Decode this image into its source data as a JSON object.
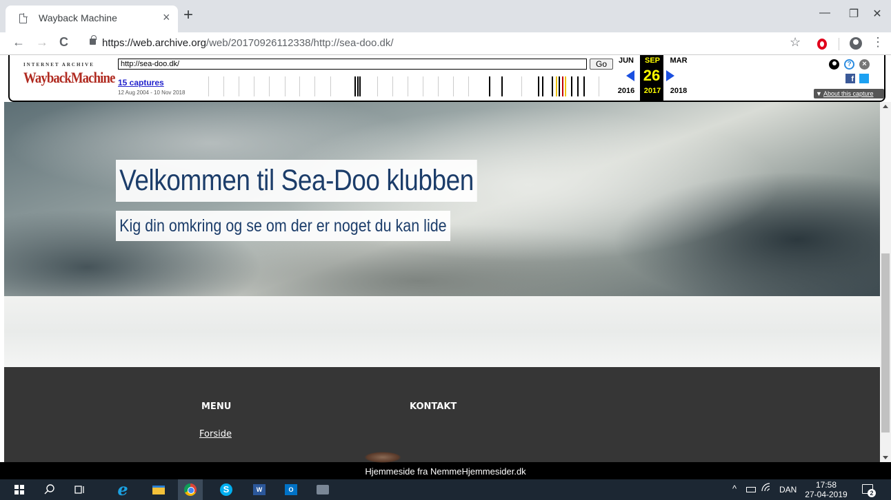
{
  "browser": {
    "tab_title": "Wayback Machine",
    "tab_close": "×",
    "new_tab": "+",
    "url_host": "https://web.archive.org",
    "url_path": "/web/20170926112338/http://sea-doo.dk/",
    "window_min": "—",
    "window_restore": "❐",
    "window_close": "✕",
    "back": "←",
    "forward": "→",
    "reload": "C",
    "star": "☆",
    "menu": "⋮"
  },
  "wayback": {
    "logo_top": "INTERNET ARCHIVE",
    "logo": "WaybackMachine",
    "url_value": "http://sea-doo.dk/",
    "go_label": "Go",
    "captures_label": "15 captures",
    "date_range": "12 Aug 2004 - 10 Nov 2018",
    "months": {
      "prev": "JUN",
      "current": "SEP",
      "next": "MAR"
    },
    "day": "26",
    "years": {
      "prev": "2016",
      "current": "2017",
      "next": "2018"
    },
    "help_glyph": "?",
    "close_glyph": "×",
    "facebook_glyph": "f",
    "about_label": "About this capture",
    "about_arrow": "▼",
    "sparkline": [
      {
        "x": 0.03,
        "c": "#ccc"
      },
      {
        "x": 0.068,
        "c": "#ccc"
      },
      {
        "x": 0.105,
        "c": "#ccc"
      },
      {
        "x": 0.142,
        "c": "#ccc"
      },
      {
        "x": 0.18,
        "c": "#ccc"
      },
      {
        "x": 0.218,
        "c": "#ccc"
      },
      {
        "x": 0.255,
        "c": "#ccc"
      },
      {
        "x": 0.292,
        "c": "#ccc"
      },
      {
        "x": 0.33,
        "c": "#ccc"
      },
      {
        "x": 0.39,
        "c": "#000",
        "w": 2
      },
      {
        "x": 0.396,
        "c": "#000",
        "w": 2
      },
      {
        "x": 0.402,
        "c": "#000",
        "w": 2
      },
      {
        "x": 0.445,
        "c": "#ccc"
      },
      {
        "x": 0.483,
        "c": "#ccc"
      },
      {
        "x": 0.52,
        "c": "#ccc"
      },
      {
        "x": 0.558,
        "c": "#ccc"
      },
      {
        "x": 0.595,
        "c": "#ccc"
      },
      {
        "x": 0.633,
        "c": "#ccc"
      },
      {
        "x": 0.67,
        "c": "#ccc"
      },
      {
        "x": 0.72,
        "c": "#000",
        "w": 2
      },
      {
        "x": 0.75,
        "c": "#000",
        "w": 2
      },
      {
        "x": 0.8,
        "c": "#ccc"
      },
      {
        "x": 0.84,
        "c": "#000",
        "w": 2
      },
      {
        "x": 0.85,
        "c": "#000",
        "w": 2
      },
      {
        "x": 0.875,
        "c": "#000",
        "w": 2
      },
      {
        "x": 0.885,
        "c": "#f0c000",
        "w": 2
      },
      {
        "x": 0.892,
        "c": "#000",
        "w": 2
      },
      {
        "x": 0.9,
        "c": "#c00000",
        "w": 2
      },
      {
        "x": 0.907,
        "c": "#f0c000",
        "w": 2
      },
      {
        "x": 0.922,
        "c": "#000",
        "w": 2
      },
      {
        "x": 0.937,
        "c": "#000",
        "w": 2
      },
      {
        "x": 0.953,
        "c": "#000",
        "w": 2
      },
      {
        "x": 0.99,
        "c": "#ccc"
      }
    ]
  },
  "site": {
    "hero_title": "Velkommen til Sea-Doo klubben",
    "hero_subtitle": "Kig din omkring og se om der er noget du kan lide",
    "footer_menu_heading": "MENU",
    "footer_kontakt_heading": "KONTAKT",
    "footer_link_forside": "Forside",
    "banner_text": "Hjemmeside fra NemmeHjemmesider.dk"
  },
  "taskbar": {
    "ie_glyph": "e",
    "skype_glyph": "S",
    "word_glyph": "W",
    "outlook_glyph": "O",
    "tray_up": "^",
    "lang": "DAN",
    "time": "17:58",
    "date": "27-04-2019",
    "notification_count": "2"
  },
  "colors": {
    "wayback_highlight": "#ffff00",
    "wayback_nav_arrow": "#1a4fe0",
    "hero_text": "#1c3d6a",
    "footer_bg": "#363636",
    "taskbar_bg": "#1c2733"
  }
}
